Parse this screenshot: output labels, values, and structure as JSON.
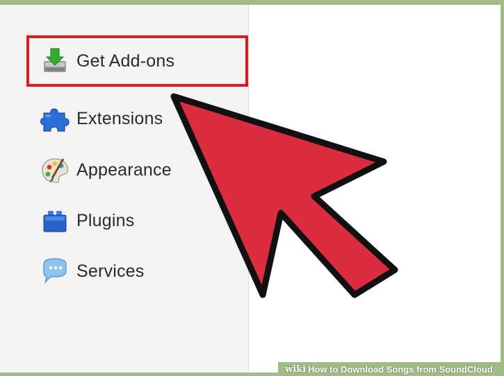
{
  "sidebar": {
    "items": [
      {
        "label": "Get Add-ons",
        "icon": "download-tray-icon",
        "selected": true
      },
      {
        "label": "Extensions",
        "icon": "puzzle-piece-icon"
      },
      {
        "label": "Appearance",
        "icon": "palette-icon"
      },
      {
        "label": "Plugins",
        "icon": "lego-block-icon"
      },
      {
        "label": "Services",
        "icon": "speech-bubble-icon"
      }
    ]
  },
  "annotation": {
    "highlight_color": "#e01a1a",
    "arrow_color": "#dc2c40",
    "arrow_points_to": "Get Add-ons"
  },
  "footer": {
    "brand": "wiki",
    "title": "How to Download Songs from SoundCloud"
  },
  "colors": {
    "frame_border": "#9fbb86",
    "sidebar_bg": "#f3f3f3"
  }
}
